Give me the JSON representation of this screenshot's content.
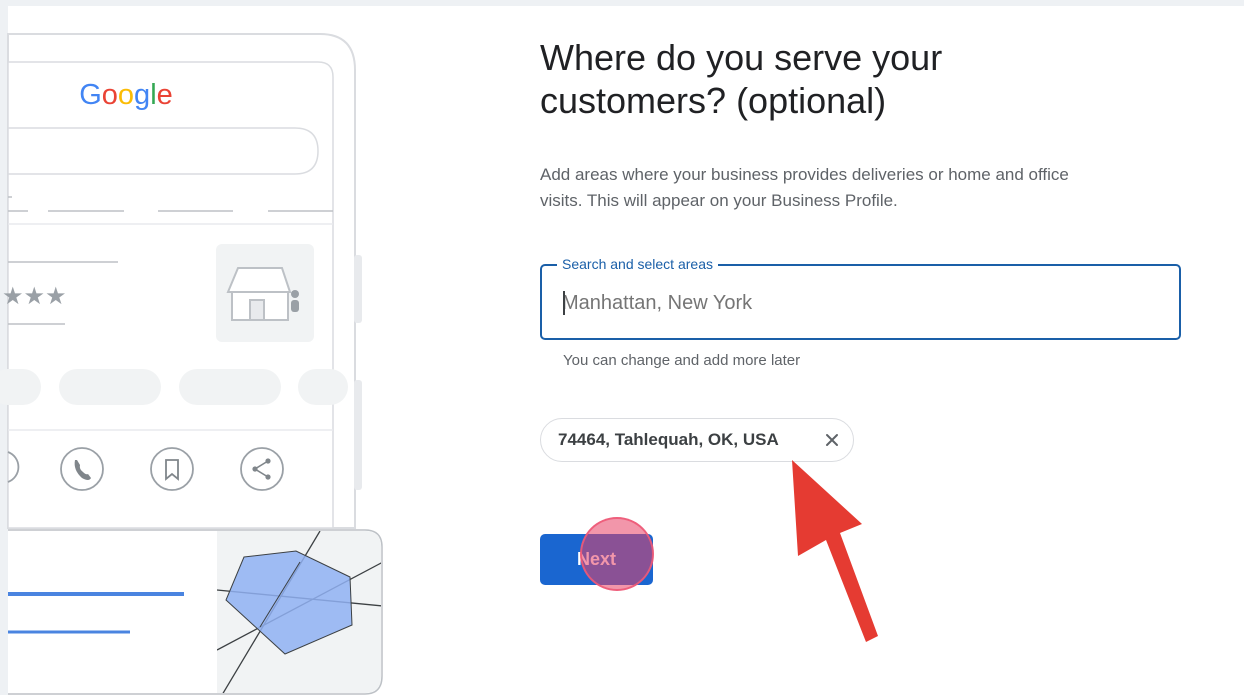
{
  "illustration": {
    "brand": "Google",
    "brand_letters": [
      {
        "ch": "G",
        "color": "#4285F4"
      },
      {
        "ch": "o",
        "color": "#EA4335"
      },
      {
        "ch": "o",
        "color": "#FBBC05"
      },
      {
        "ch": "g",
        "color": "#4285F4"
      },
      {
        "ch": "l",
        "color": "#34A853"
      },
      {
        "ch": "e",
        "color": "#EA4335"
      }
    ],
    "rating_stars": "★★★",
    "action_icons": [
      "phone-icon",
      "bookmark-icon",
      "share-icon"
    ]
  },
  "heading": {
    "line1": "Where do you serve your",
    "line2": "customers? (optional)"
  },
  "description": {
    "line1": "Add areas where your business provides deliveries or home and office",
    "line2": "visits. This will appear on your Business Profile."
  },
  "search": {
    "label": "Search and select areas",
    "placeholder": "Manhattan, New York",
    "value": ""
  },
  "helper_text": "You can change and add more later",
  "chips": [
    {
      "label": "74464, Tahlequah, OK, USA",
      "close_icon": "close-icon"
    }
  ],
  "next_button": {
    "label": "Next"
  },
  "colors": {
    "accent": "#1a5fa8",
    "primary_button": "#1a66d0",
    "annotation_arrow": "#e53b32",
    "click_marker": "#e74064"
  }
}
